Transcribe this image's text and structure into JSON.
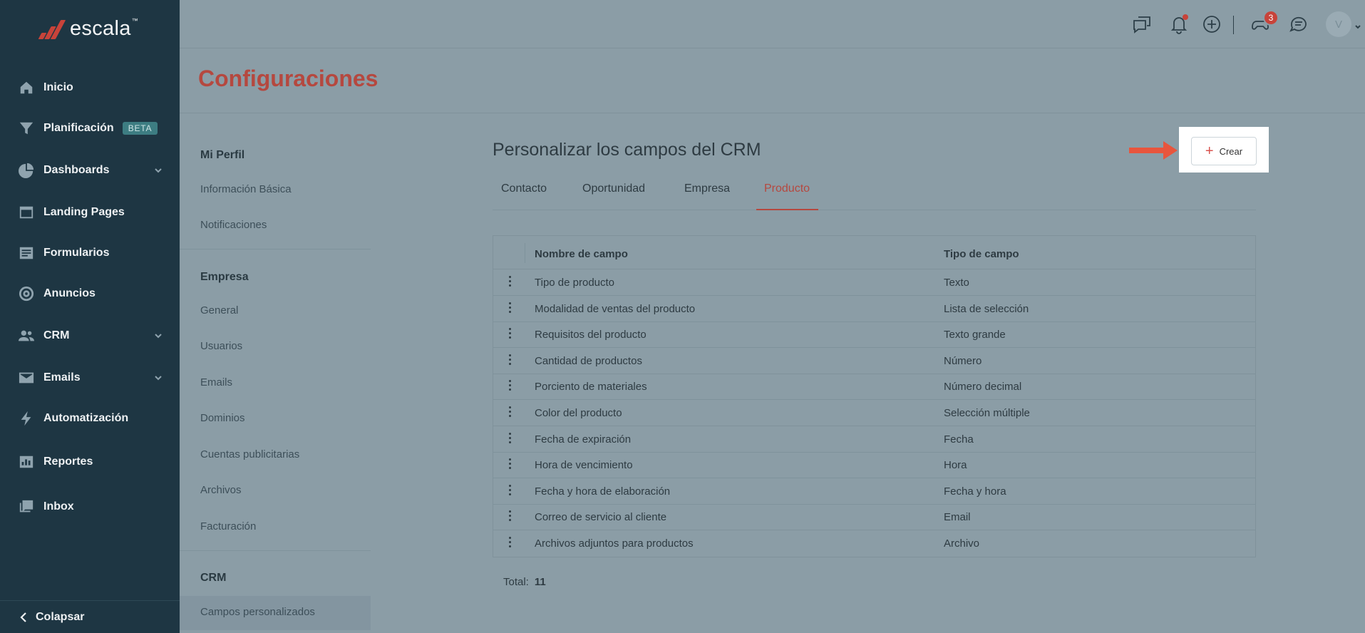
{
  "brand": {
    "name": "escala",
    "tm": "™"
  },
  "sidebar": {
    "items": [
      {
        "label": "Inicio",
        "icon": "home-icon"
      },
      {
        "label": "Planificación",
        "icon": "funnel-icon",
        "badge": "BETA"
      },
      {
        "label": "Dashboards",
        "icon": "pie-chart-icon",
        "expandable": true
      },
      {
        "label": "Landing Pages",
        "icon": "browser-icon"
      },
      {
        "label": "Formularios",
        "icon": "form-icon"
      },
      {
        "label": "Anuncios",
        "icon": "target-icon"
      },
      {
        "label": "CRM",
        "icon": "people-icon",
        "expandable": true
      },
      {
        "label": "Emails",
        "icon": "mail-icon",
        "expandable": true
      },
      {
        "label": "Automatización",
        "icon": "bolt-icon"
      },
      {
        "label": "Reportes",
        "icon": "report-icon"
      },
      {
        "label": "Inbox",
        "icon": "inbox-icon"
      }
    ],
    "collapse_label": "Colapsar"
  },
  "topbar": {
    "notification_count": "3",
    "avatar_initial": "V"
  },
  "page": {
    "title": "Configuraciones"
  },
  "settings_menu": {
    "sections": [
      {
        "heading": "Mi Perfil",
        "items": [
          "Información Básica",
          "Notificaciones"
        ]
      },
      {
        "heading": "Empresa",
        "items": [
          "General",
          "Usuarios",
          "Emails",
          "Dominios",
          "Cuentas publicitarias",
          "Archivos",
          "Facturación"
        ]
      },
      {
        "heading": "CRM",
        "items": [
          "Campos personalizados"
        ]
      }
    ]
  },
  "main": {
    "title": "Personalizar los campos del CRM",
    "create_label": "Crear",
    "tabs": [
      "Contacto",
      "Oportunidad",
      "Empresa",
      "Producto"
    ],
    "active_tab": "Producto",
    "table": {
      "headers": [
        "Nombre de campo",
        "Tipo de campo"
      ],
      "rows": [
        [
          "Tipo de producto",
          "Texto"
        ],
        [
          "Modalidad de ventas del producto",
          "Lista de selección"
        ],
        [
          "Requisitos del producto",
          "Texto grande"
        ],
        [
          "Cantidad de productos",
          "Número"
        ],
        [
          "Porciento de materiales",
          "Número decimal"
        ],
        [
          "Color del producto",
          "Selección múltiple"
        ],
        [
          "Fecha de expiración",
          "Fecha"
        ],
        [
          "Hora de vencimiento",
          "Hora"
        ],
        [
          "Fecha y hora de elaboración",
          "Fecha y hora"
        ],
        [
          "Correo de servicio al cliente",
          "Email"
        ],
        [
          "Archivos adjuntos para productos",
          "Archivo"
        ]
      ]
    },
    "total_label": "Total:",
    "total_value": "11"
  },
  "colors": {
    "sidebar": "#1e3643",
    "overlay": "#8b9da6",
    "accent": "#b5483f",
    "arrow": "#e8553d"
  }
}
